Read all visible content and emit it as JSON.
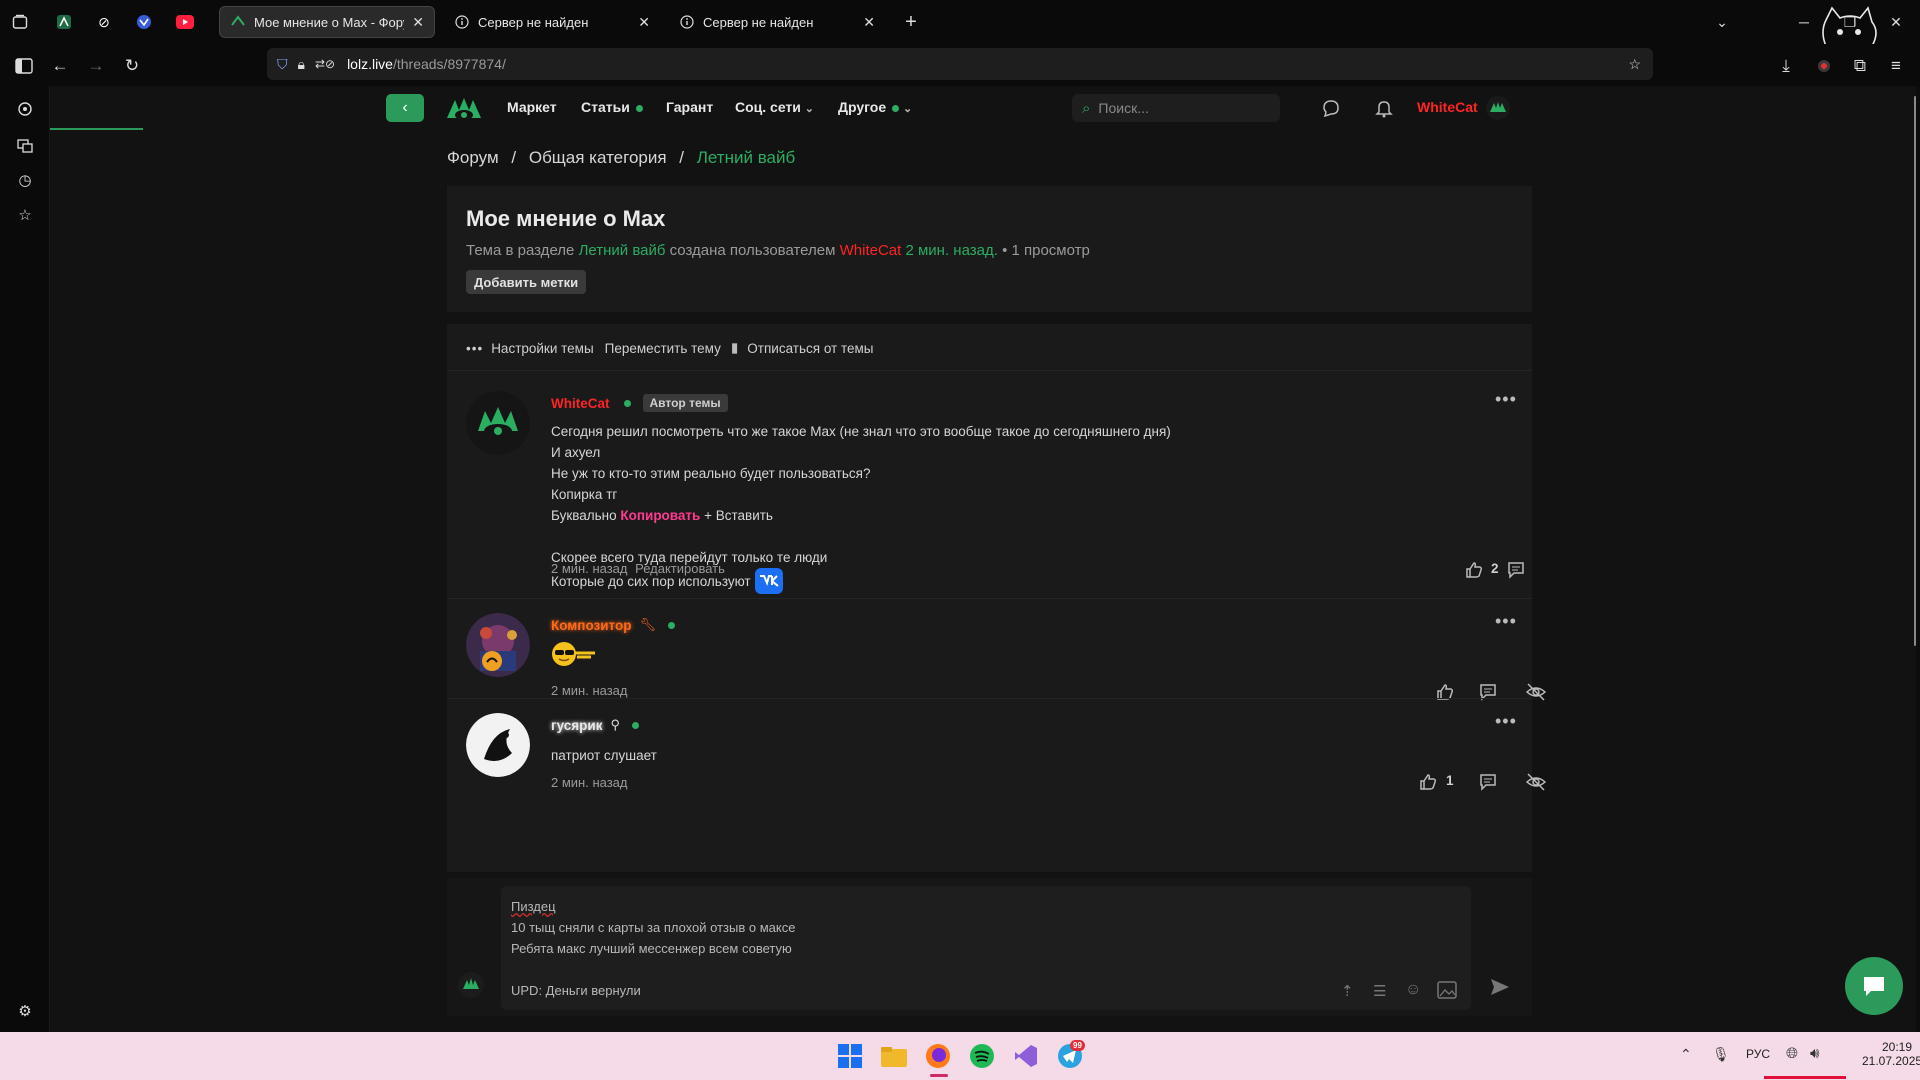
{
  "browser": {
    "tabs": [
      {
        "title": "Мое мнение о Max - Форум с",
        "active": true
      },
      {
        "title": "Сервер не найден",
        "active": false
      },
      {
        "title": "Сервер не найден",
        "active": false
      }
    ],
    "new_tab": "+",
    "url_domain": "lolz.live",
    "url_path": "/threads/8977874/"
  },
  "site": {
    "nav": {
      "market": "Маркет",
      "articles": "Статьи",
      "guarantor": "Гарант",
      "social": "Соц. сети",
      "other": "Другое",
      "search_placeholder": "Поиск...",
      "username": "WhiteCat"
    },
    "breadcrumb": {
      "forum": "Форум",
      "sep": "/",
      "category": "Общая категория",
      "section": "Летний вайб"
    },
    "thread": {
      "title": "Мое мнение о Max",
      "meta_prefix": "Тема в разделе",
      "meta_section": "Летний вайб",
      "meta_created": "создана пользователем",
      "meta_author": "WhiteCat",
      "meta_time": "2 мин. назад.",
      "meta_views": "• 1 просмотр",
      "add_tags": "Добавить метки"
    },
    "tools": {
      "settings": "Настройки темы",
      "move": "Переместить тему",
      "unsubscribe": "Отписаться от темы"
    },
    "posts": [
      {
        "author": "WhiteCat",
        "badge": "Автор темы",
        "lines": [
          "Сегодня решил посмотреть что же такое Max (не знал что это вообще такое до сегодняшнего дня)",
          "И ахуел",
          "Не уж то кто-то этим реально будет пользоваться?",
          "Копирка тг"
        ],
        "line5_pre": "Буквально ",
        "line5_highlight": "Копировать",
        "line5_post": " + Вставить",
        "line6": "Скорее всего туда перейдут только те люди",
        "line7": "Которые до сих пор используют",
        "time": "2 мин. назад",
        "edit": "Редактировать",
        "likes": "2"
      },
      {
        "author": "Композитор",
        "time": "2 мин. назад"
      },
      {
        "author": "гусярик",
        "text": "патриот слушает",
        "time": "2 мин. назад",
        "likes": "1"
      }
    ],
    "reply": {
      "lines": [
        "Пиздец",
        "10 тыщ сняли с карты за плохой отзыв о максе",
        "Ребята макс лучший мессенжер всем советую",
        "",
        "UPD: Деньги вернули"
      ]
    }
  },
  "taskbar": {
    "lang": "РУС",
    "time": "20:19",
    "date": "21.07.2025",
    "telegram_badge": "99"
  },
  "colors": {
    "accent_green": "#2bad62",
    "author_red": "#ff2424",
    "highlight_pink": "#ff3b8e",
    "composer_orange": "#ff6a1a"
  }
}
